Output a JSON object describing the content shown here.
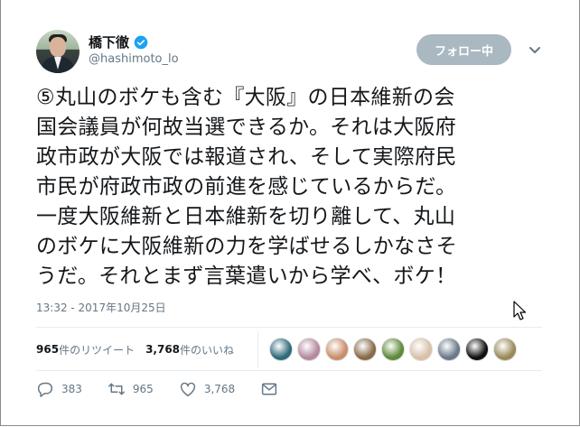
{
  "user": {
    "display_name": "橋下徹",
    "handle": "@hashimoto_lo",
    "verified": true
  },
  "follow_button_label": "フォロー中",
  "tweet": {
    "text": "⑤丸山のボケも含む『大阪』の日本維新の会\n国会議員が何故当選できるか。それは大阪府\n政市政が大阪では報道され、そして実際府民\n市民が府政市政の前進を感じているからだ。\n一度大阪維新と日本維新を切り離して、丸山\nのボケに大阪維新の力を学ばせるしかなさそ\nうだ。それとまず言葉遣いから学べ、ボケ！",
    "timestamp": "13:32 - 2017年10月25日"
  },
  "stats": {
    "retweet_count": "965",
    "retweet_label": "件のリツイート",
    "like_count": "3,768",
    "like_label": "件のいいね"
  },
  "likers": [
    {
      "color": "#2f6b7a"
    },
    {
      "color": "#b58aa0"
    },
    {
      "color": "#c98f6a"
    },
    {
      "color": "#8a6a4a"
    },
    {
      "color": "#5f8a3a"
    },
    {
      "color": "#d9c0a8"
    },
    {
      "color": "#6a7a8a"
    },
    {
      "color": "#111111"
    },
    {
      "color": "#9a8a5a"
    }
  ],
  "actions": {
    "reply_count": "383",
    "retweet_count": "965",
    "like_count": "3,768"
  },
  "colors": {
    "accent": "#1da1f2",
    "follow_button_bg": "#aab8c2",
    "secondary_text": "#657786"
  }
}
